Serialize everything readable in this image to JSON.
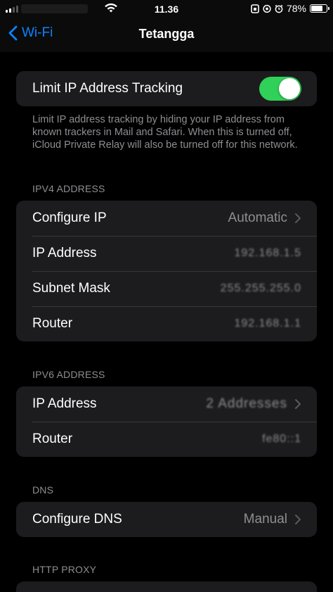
{
  "status_bar": {
    "time": "11.36",
    "battery": "78%",
    "battery_level": 0.78
  },
  "nav": {
    "back_label": "Wi-Fi",
    "title": "Tetangga"
  },
  "tracking": {
    "label": "Limit IP Address Tracking",
    "enabled": true,
    "footnote": "Limit IP address tracking by hiding your IP address from known trackers in Mail and Safari. When this is turned off, iCloud Private Relay will also be turned off for this network."
  },
  "ipv4": {
    "header": "IPV4 ADDRESS",
    "configure_ip_label": "Configure IP",
    "configure_ip_value": "Automatic",
    "ip_label": "IP Address",
    "ip_value": "192.168.1.5",
    "subnet_label": "Subnet Mask",
    "subnet_value": "255.255.255.0",
    "router_label": "Router",
    "router_value": "192.168.1.1"
  },
  "ipv6": {
    "header": "IPV6 ADDRESS",
    "ip_label": "IP Address",
    "ip_value": "2 Addresses",
    "router_label": "Router",
    "router_value": "fe80::1"
  },
  "dns": {
    "header": "DNS",
    "configure_label": "Configure DNS",
    "configure_value": "Manual"
  },
  "proxy": {
    "header": "HTTP PROXY"
  },
  "colors": {
    "accent": "#0a84ff",
    "toggle_on": "#30d158",
    "cell_bg": "#1c1c1e",
    "secondary_text": "#8e8e93"
  }
}
